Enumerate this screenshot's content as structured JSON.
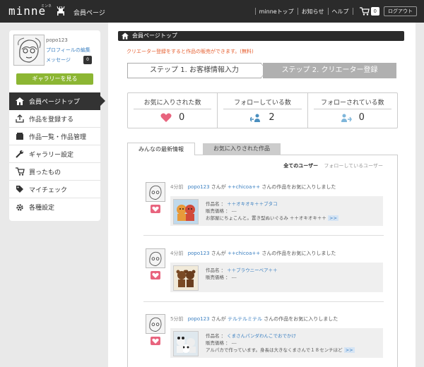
{
  "header": {
    "logo": "minne",
    "logo_sub": "ミンネ",
    "member_page": "会員ページ",
    "nav": [
      "minneトップ",
      "お知らせ",
      "ヘルプ"
    ],
    "cart_count": "0",
    "logout": "ログアウト"
  },
  "sidebar": {
    "username": "popo123",
    "profile_edit": "プロフィールの編集",
    "messages": "メッセージ",
    "message_count": "0",
    "gallery_button": "ギャラリーを見る",
    "items": [
      {
        "label": "会員ページトップ",
        "icon": "home-icon"
      },
      {
        "label": "作品を登録する",
        "icon": "upload-icon"
      },
      {
        "label": "作品一覧・作品管理",
        "icon": "list-icon"
      },
      {
        "label": "ギャラリー設定",
        "icon": "wrench-icon"
      },
      {
        "label": "買ったもの",
        "icon": "cart-icon"
      },
      {
        "label": "マイチェック",
        "icon": "tag-icon"
      },
      {
        "label": "各種設定",
        "icon": "gear-icon"
      }
    ]
  },
  "main": {
    "page_title": "会員ページトップ",
    "notice": "クリエーター登録をすると作品の販売ができます。(無料)",
    "step1": "ステップ 1. お客様情報入力",
    "step2": "ステップ 2. クリエーター登録",
    "stats": [
      {
        "label": "お気に入りされた数",
        "value": "0",
        "icon": "heart-icon"
      },
      {
        "label": "フォローしている数",
        "value": "2",
        "icon": "following-icon"
      },
      {
        "label": "フォローされている数",
        "value": "0",
        "icon": "followers-icon"
      }
    ],
    "tabs": [
      "みんなの最新情報",
      "お気に入りされた作品"
    ],
    "filter": {
      "all": "全てのユーザー",
      "following": "フォローしているユーザー"
    },
    "feed": [
      {
        "time": "4分前",
        "user": "popo123",
        "san1": "さんが",
        "target": "++chicoa++",
        "suffix": "さんの作品をお気に入りしました",
        "name_label": "作品名 ：",
        "name": "＋＋オキオキ＋＋ブタコ",
        "price_label": "販売価格 ：",
        "price": "---",
        "desc": "お部屋にちょこんと。置き型ぬいぐるみ ＋＋オキオキ＋＋",
        "more": ">>"
      },
      {
        "time": "4分前",
        "user": "popo123",
        "san1": "さんが",
        "target": "++chicoa++",
        "suffix": "さんの作品をお気に入りしました",
        "name_label": "作品名 ：",
        "name": "＋＋ブラウニーベア＋＋",
        "price_label": "販売価格 ：",
        "price": "---",
        "desc": "",
        "more": ""
      },
      {
        "time": "5分前",
        "user": "popo123",
        "san1": "さんが",
        "target": "テルテルミテル",
        "suffix": "さんの作品をお気に入りしました",
        "name_label": "作品名 ：",
        "name": "くまさんパンダわんこでおでかけ",
        "price_label": "販売価格 ：",
        "price": "---",
        "desc": "アルパカで作っています。身長は大きなくまさんで１８センチほど",
        "more": ">>"
      }
    ]
  }
}
